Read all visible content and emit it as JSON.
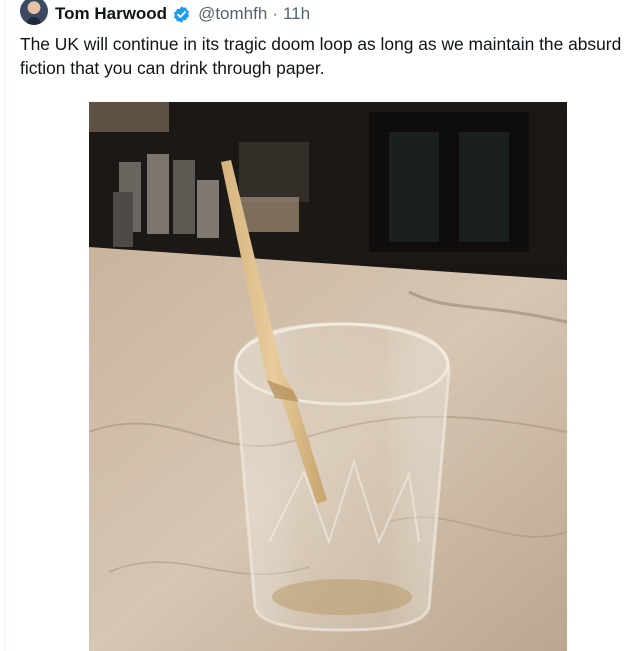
{
  "tweet": {
    "author_name": "Tom Harwood",
    "handle": "@tomhfh",
    "separator": "·",
    "time": "11h",
    "text": "The UK will continue in its tragic doom loop as long as we maintain the absurd fiction that you can drink through paper.",
    "verified_color": "#1d9bf0"
  },
  "icons": {
    "avatar": "profile-photo",
    "verified": "verified-badge-icon"
  },
  "media": {
    "image_subject": "glass-with-paper-straw-photo"
  }
}
